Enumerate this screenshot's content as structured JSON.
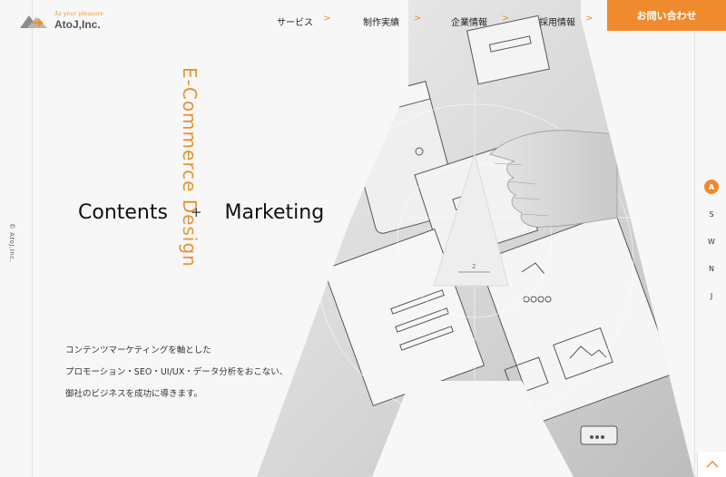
{
  "brand": {
    "tagline": "As your pleasure",
    "name": "AtoJ,Inc."
  },
  "nav": {
    "items": [
      {
        "label": "サービス"
      },
      {
        "label": "制作実績"
      },
      {
        "label": "企業情報"
      },
      {
        "label": "採用情報"
      }
    ],
    "chevron": ">",
    "contact_label": "お問い合わせ"
  },
  "hero": {
    "vertical_tagline": "E-Commerce Design",
    "title_left": "Contents",
    "title_sep": "+",
    "title_right": "Marketing",
    "description": [
      "コンテンツマーケティングを軸とした",
      "プロモーション・SEO・UI/UX・データ分析をおこない、",
      "御社のビジネスを成功に導きます。"
    ],
    "image_label": "2"
  },
  "copyright": "© AtoJ,Inc.",
  "side_nav": {
    "items": [
      "A",
      "S",
      "W",
      "N",
      "J"
    ],
    "active": "A"
  },
  "icons": {
    "logo": "atoj-logo-icon",
    "nav_arrow": "chevron-right-icon",
    "back_to_top": "chevron-up-icon",
    "hero": "letter-a-photo-icon"
  },
  "colors": {
    "accent": "#ef8b2e",
    "background": "#f7f7f7",
    "text": "#222222"
  }
}
